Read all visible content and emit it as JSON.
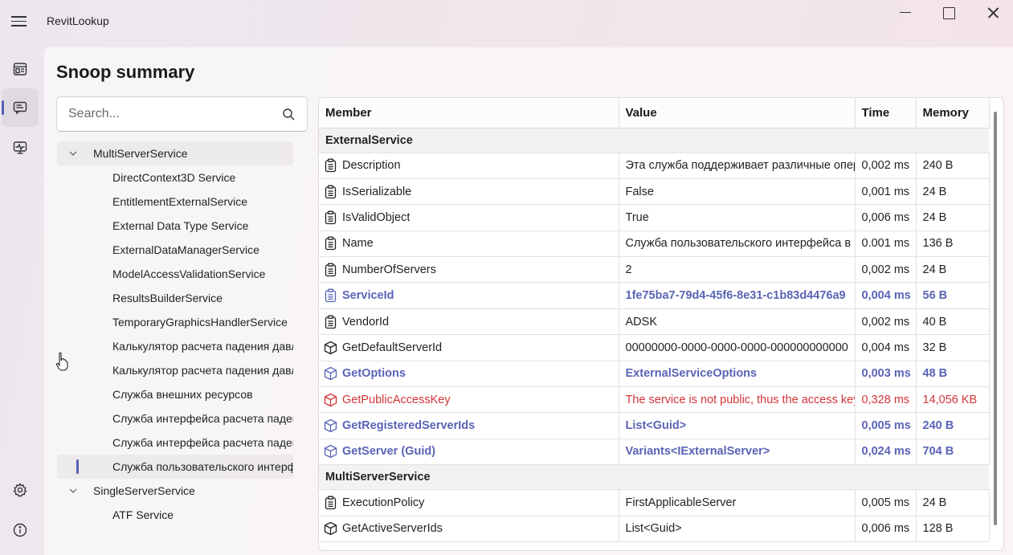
{
  "app": {
    "title": "RevitLookup"
  },
  "page": {
    "title": "Snoop summary"
  },
  "search": {
    "placeholder": "Search..."
  },
  "rail": {
    "items": [
      {
        "icon": "dashboard-icon",
        "active": false
      },
      {
        "icon": "snoop-summary-icon",
        "active": true
      },
      {
        "icon": "events-monitor-icon",
        "active": false
      },
      {
        "icon": "settings-icon",
        "active": false
      },
      {
        "icon": "info-icon",
        "active": false
      }
    ]
  },
  "tree": [
    {
      "label": "MultiServerService",
      "level": 0,
      "expanded": true,
      "highlighted": true
    },
    {
      "label": "DirectContext3D Service",
      "level": 1
    },
    {
      "label": "EntitlementExternalService",
      "level": 1
    },
    {
      "label": "External Data Type Service",
      "level": 1
    },
    {
      "label": "ExternalDataManagerService",
      "level": 1
    },
    {
      "label": "ModelAccessValidationService",
      "level": 1
    },
    {
      "label": "ResultsBuilderService",
      "level": 1
    },
    {
      "label": "TemporaryGraphicsHandlerService",
      "level": 1
    },
    {
      "label": "Калькулятор расчета падения давления",
      "level": 1
    },
    {
      "label": "Калькулятор расчета падения давления",
      "level": 1
    },
    {
      "label": "Служба внешних ресурсов",
      "level": 1
    },
    {
      "label": "Служба интерфейса расчета падения давления",
      "level": 1
    },
    {
      "label": "Служба интерфейса расчета падения давления",
      "level": 1
    },
    {
      "label": "Служба пользовательского интерфейса",
      "level": 1,
      "selected": true
    },
    {
      "label": "SingleServerService",
      "level": 0,
      "expanded": true
    },
    {
      "label": "ATF Service",
      "level": 1
    }
  ],
  "table": {
    "columns": [
      "Member",
      "Value",
      "Time",
      "Memory"
    ],
    "groups": [
      {
        "name": "ExternalService",
        "rows": [
          {
            "icon": "property-icon",
            "member": "Description",
            "value": "Эта служба поддерживает различные операции",
            "time": "0,002 ms",
            "memory": "240 B",
            "style": "normal"
          },
          {
            "icon": "property-icon",
            "member": "IsSerializable",
            "value": "False",
            "time": "0,001 ms",
            "memory": "24 B",
            "style": "normal"
          },
          {
            "icon": "property-icon",
            "member": "IsValidObject",
            "value": "True",
            "time": "0,006 ms",
            "memory": "24 B",
            "style": "normal"
          },
          {
            "icon": "property-icon",
            "member": "Name",
            "value": "Служба пользовательского интерфейса в",
            "time": "0.001 ms",
            "memory": "136 B",
            "style": "normal"
          },
          {
            "icon": "property-icon",
            "member": "NumberOfServers",
            "value": "2",
            "time": "0,002 ms",
            "memory": "24 B",
            "style": "normal"
          },
          {
            "icon": "property-icon",
            "member": "ServiceId",
            "value": "1fe75ba7-79d4-45f6-8e31-c1b83d4476a9",
            "time": "0,004 ms",
            "memory": "56 B",
            "style": "accent"
          },
          {
            "icon": "property-icon",
            "member": "VendorId",
            "value": "ADSK",
            "time": "0,002 ms",
            "memory": "40 B",
            "style": "normal"
          },
          {
            "icon": "method-icon",
            "member": "GetDefaultServerId",
            "value": "00000000-0000-0000-0000-000000000000",
            "time": "0,004 ms",
            "memory": "32 B",
            "style": "normal"
          },
          {
            "icon": "method-icon",
            "member": "GetOptions",
            "value": "ExternalServiceOptions",
            "time": "0,003 ms",
            "memory": "48 B",
            "style": "accent"
          },
          {
            "icon": "method-icon",
            "member": "GetPublicAccessKey",
            "value": "The service is not public, thus the access key",
            "time": "0,328 ms",
            "memory": "14,056 KB",
            "style": "error"
          },
          {
            "icon": "method-icon",
            "member": "GetRegisteredServerIds",
            "value": "List<Guid>",
            "time": "0,005 ms",
            "memory": "240 B",
            "style": "accent"
          },
          {
            "icon": "method-icon",
            "member": "GetServer (Guid)",
            "value": "Variants<IExternalServer>",
            "time": "0,024 ms",
            "memory": "704 B",
            "style": "accent"
          }
        ]
      },
      {
        "name": "MultiServerService",
        "rows": [
          {
            "icon": "property-icon",
            "member": "ExecutionPolicy",
            "value": "FirstApplicableServer",
            "time": "0,005 ms",
            "memory": "24 B",
            "style": "normal"
          },
          {
            "icon": "method-icon",
            "member": "GetActiveServerIds",
            "value": "List<Guid>",
            "time": "0,006 ms",
            "memory": "128 B",
            "style": "normal"
          }
        ]
      }
    ]
  },
  "colors": {
    "accent": "#5a63b6",
    "error": "#d13438",
    "indicator": "#5561b0"
  }
}
